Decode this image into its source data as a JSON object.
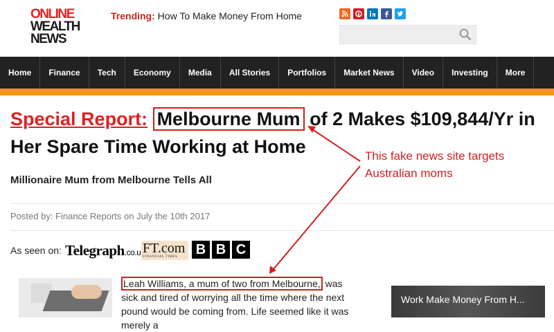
{
  "logo": {
    "line1": "ONLINE",
    "line2": "WEALTH",
    "line3": "NEWS"
  },
  "trending": {
    "label": "Trending:",
    "text": "How To Make Money From Home"
  },
  "social": [
    "rss-icon",
    "pinterest-icon",
    "linkedin-icon",
    "facebook-icon",
    "twitter-icon"
  ],
  "search": {
    "placeholder": ""
  },
  "nav": [
    "Home",
    "Finance",
    "Tech",
    "Economy",
    "Media",
    "All Stories",
    "Portfolios",
    "Market News",
    "Video",
    "Investing",
    "More"
  ],
  "headline": {
    "special": "Special Report:",
    "boxed": "Melbourne Mum",
    "rest": "of 2 Makes $109,844/Yr in Her Spare Time Working at Home"
  },
  "subtitle": "Millionaire Mum from Melbourne Tells All",
  "posted": "Posted by: Finance Reports on July the 10th 2017",
  "as_seen_on": {
    "label": "As seen on:",
    "telegraph": "Telegraph",
    "telegraph_suffix": ".co.uk",
    "ft": "FT.com",
    "ft_sub": "FINANCIAL TIMES",
    "bbc": [
      "B",
      "B",
      "C"
    ]
  },
  "article": {
    "boxed": "Leah Williams, a mum of two from Melbourne,",
    "rest": " was sick and tired of worrying all the time where the next pound would be coming from. Life seemed like it was merely a"
  },
  "video": {
    "title": "Work Make Money From H..."
  },
  "annotation": {
    "line1": "This fake news site targets",
    "line2": "Australian moms"
  },
  "colors": {
    "accent_red": "#cc1f1f",
    "nav_bg": "#222222",
    "orange_bar": "#f7941d"
  }
}
